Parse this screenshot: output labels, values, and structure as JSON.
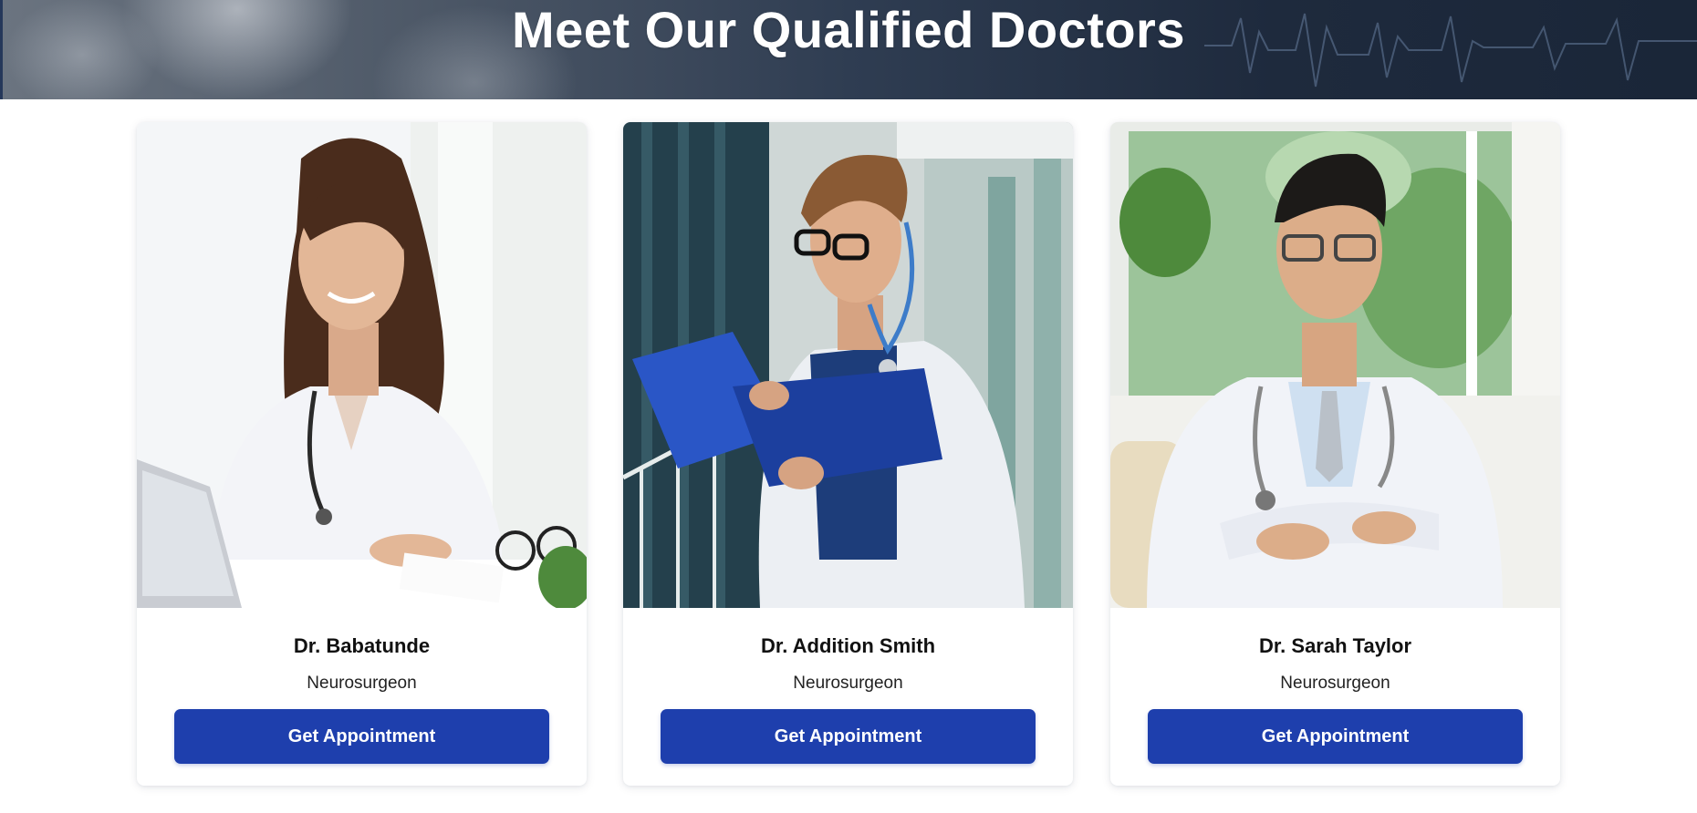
{
  "hero": {
    "title": "Meet Our Qualified Doctors"
  },
  "doctors": [
    {
      "name": "Dr. Babatunde",
      "specialty": "Neurosurgeon",
      "button_label": "Get Appointment"
    },
    {
      "name": "Dr. Addition Smith",
      "specialty": "Neurosurgeon",
      "button_label": "Get Appointment"
    },
    {
      "name": "Dr. Sarah Taylor",
      "specialty": "Neurosurgeon",
      "button_label": "Get Appointment"
    }
  ],
  "colors": {
    "button_bg": "#1e3fad",
    "button_text": "#ffffff",
    "hero_dark": "#1e2a3d"
  }
}
